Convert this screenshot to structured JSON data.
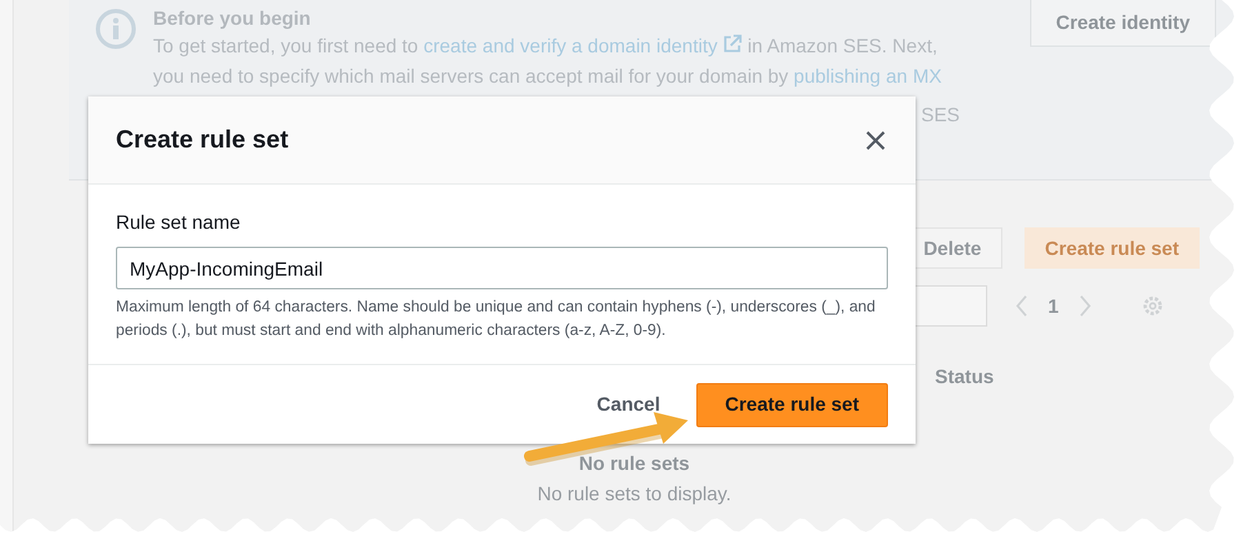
{
  "page": {
    "info": {
      "title": "Before you begin",
      "parts": [
        {
          "kind": "text",
          "text": "To get started, you first need to "
        },
        {
          "kind": "external_link",
          "text": "create and verify a domain identity"
        },
        {
          "kind": "text",
          "text": " in Amazon SES. Next, you need to specify which mail servers can accept mail for your domain by "
        },
        {
          "kind": "link",
          "text": "publishing an MX"
        }
      ],
      "tail_fragment": "SES"
    },
    "identity_button": "Create identity",
    "toolbar_buttons": [
      {
        "label": "Delete",
        "kind": "plain"
      },
      {
        "label": "Create rule set",
        "kind": "primary"
      }
    ],
    "pager": {
      "page": "1"
    },
    "column": "Status",
    "empty": {
      "title": "No rule sets",
      "text": "No rule sets to display."
    }
  },
  "dialog": {
    "title": "Create rule set",
    "field": {
      "label": "Rule set name",
      "value": "MyApp-IncomingEmail",
      "hint": "Maximum length of 64 characters. Name should be unique and can contain hyphens (-), underscores (_), and periods (.), but must start and end with alphanumeric characters (a-z, A-Z, 0-9)."
    },
    "buttons": [
      {
        "label": "Cancel",
        "kind": "link"
      },
      {
        "label": "Create rule set",
        "kind": "primary"
      }
    ]
  }
}
